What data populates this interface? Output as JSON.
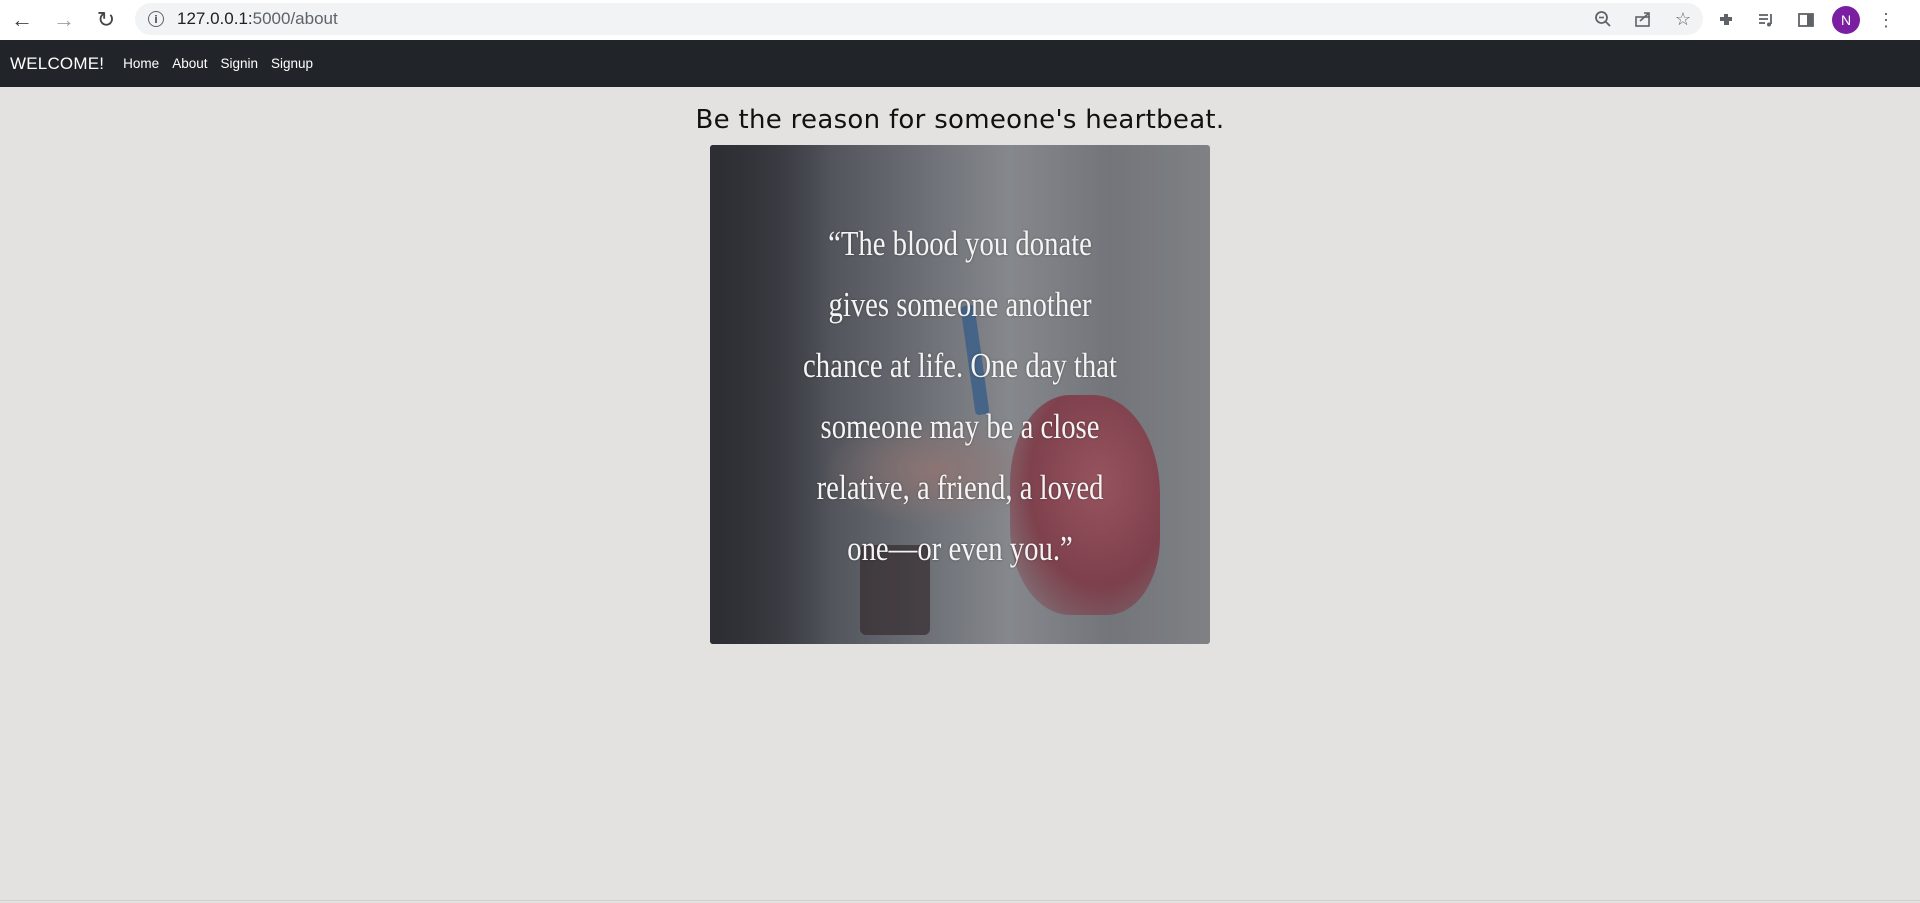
{
  "browser": {
    "url_host": "127.0.0.1:",
    "url_rest": "5000/about",
    "profile_initial": "N",
    "icons": [
      "back-icon",
      "forward-icon",
      "reload-icon",
      "info-icon",
      "zoom-out-icon",
      "share-icon",
      "star-icon",
      "extensions-icon",
      "media-icon",
      "side-panel-icon",
      "menu-icon"
    ]
  },
  "navbar": {
    "brand": "WELCOME!",
    "links": [
      "Home",
      "About",
      "Signin",
      "Signup"
    ]
  },
  "main": {
    "headline": "Be the reason for someone's heartbeat.",
    "image_quote_lines": [
      "“The blood you donate",
      "gives someone another",
      "chance at life. One day that",
      "someone may be a close",
      "relative, a friend, a loved",
      "one—or even you.”"
    ]
  },
  "colors": {
    "page_bg": "#e3e2e0",
    "navbar_bg": "#212529",
    "avatar": "#7b1fa2"
  }
}
